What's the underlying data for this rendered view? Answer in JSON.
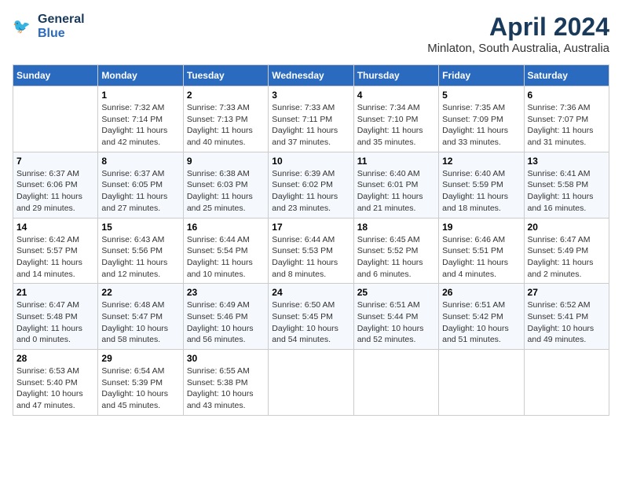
{
  "header": {
    "logo_line1": "General",
    "logo_line2": "Blue",
    "title": "April 2024",
    "subtitle": "Minlaton, South Australia, Australia"
  },
  "days_of_week": [
    "Sunday",
    "Monday",
    "Tuesday",
    "Wednesday",
    "Thursday",
    "Friday",
    "Saturday"
  ],
  "weeks": [
    [
      {
        "day": "",
        "info": ""
      },
      {
        "day": "1",
        "info": "Sunrise: 7:32 AM\nSunset: 7:14 PM\nDaylight: 11 hours\nand 42 minutes."
      },
      {
        "day": "2",
        "info": "Sunrise: 7:33 AM\nSunset: 7:13 PM\nDaylight: 11 hours\nand 40 minutes."
      },
      {
        "day": "3",
        "info": "Sunrise: 7:33 AM\nSunset: 7:11 PM\nDaylight: 11 hours\nand 37 minutes."
      },
      {
        "day": "4",
        "info": "Sunrise: 7:34 AM\nSunset: 7:10 PM\nDaylight: 11 hours\nand 35 minutes."
      },
      {
        "day": "5",
        "info": "Sunrise: 7:35 AM\nSunset: 7:09 PM\nDaylight: 11 hours\nand 33 minutes."
      },
      {
        "day": "6",
        "info": "Sunrise: 7:36 AM\nSunset: 7:07 PM\nDaylight: 11 hours\nand 31 minutes."
      }
    ],
    [
      {
        "day": "7",
        "info": "Sunrise: 6:37 AM\nSunset: 6:06 PM\nDaylight: 11 hours\nand 29 minutes."
      },
      {
        "day": "8",
        "info": "Sunrise: 6:37 AM\nSunset: 6:05 PM\nDaylight: 11 hours\nand 27 minutes."
      },
      {
        "day": "9",
        "info": "Sunrise: 6:38 AM\nSunset: 6:03 PM\nDaylight: 11 hours\nand 25 minutes."
      },
      {
        "day": "10",
        "info": "Sunrise: 6:39 AM\nSunset: 6:02 PM\nDaylight: 11 hours\nand 23 minutes."
      },
      {
        "day": "11",
        "info": "Sunrise: 6:40 AM\nSunset: 6:01 PM\nDaylight: 11 hours\nand 21 minutes."
      },
      {
        "day": "12",
        "info": "Sunrise: 6:40 AM\nSunset: 5:59 PM\nDaylight: 11 hours\nand 18 minutes."
      },
      {
        "day": "13",
        "info": "Sunrise: 6:41 AM\nSunset: 5:58 PM\nDaylight: 11 hours\nand 16 minutes."
      }
    ],
    [
      {
        "day": "14",
        "info": "Sunrise: 6:42 AM\nSunset: 5:57 PM\nDaylight: 11 hours\nand 14 minutes."
      },
      {
        "day": "15",
        "info": "Sunrise: 6:43 AM\nSunset: 5:56 PM\nDaylight: 11 hours\nand 12 minutes."
      },
      {
        "day": "16",
        "info": "Sunrise: 6:44 AM\nSunset: 5:54 PM\nDaylight: 11 hours\nand 10 minutes."
      },
      {
        "day": "17",
        "info": "Sunrise: 6:44 AM\nSunset: 5:53 PM\nDaylight: 11 hours\nand 8 minutes."
      },
      {
        "day": "18",
        "info": "Sunrise: 6:45 AM\nSunset: 5:52 PM\nDaylight: 11 hours\nand 6 minutes."
      },
      {
        "day": "19",
        "info": "Sunrise: 6:46 AM\nSunset: 5:51 PM\nDaylight: 11 hours\nand 4 minutes."
      },
      {
        "day": "20",
        "info": "Sunrise: 6:47 AM\nSunset: 5:49 PM\nDaylight: 11 hours\nand 2 minutes."
      }
    ],
    [
      {
        "day": "21",
        "info": "Sunrise: 6:47 AM\nSunset: 5:48 PM\nDaylight: 11 hours\nand 0 minutes."
      },
      {
        "day": "22",
        "info": "Sunrise: 6:48 AM\nSunset: 5:47 PM\nDaylight: 10 hours\nand 58 minutes."
      },
      {
        "day": "23",
        "info": "Sunrise: 6:49 AM\nSunset: 5:46 PM\nDaylight: 10 hours\nand 56 minutes."
      },
      {
        "day": "24",
        "info": "Sunrise: 6:50 AM\nSunset: 5:45 PM\nDaylight: 10 hours\nand 54 minutes."
      },
      {
        "day": "25",
        "info": "Sunrise: 6:51 AM\nSunset: 5:44 PM\nDaylight: 10 hours\nand 52 minutes."
      },
      {
        "day": "26",
        "info": "Sunrise: 6:51 AM\nSunset: 5:42 PM\nDaylight: 10 hours\nand 51 minutes."
      },
      {
        "day": "27",
        "info": "Sunrise: 6:52 AM\nSunset: 5:41 PM\nDaylight: 10 hours\nand 49 minutes."
      }
    ],
    [
      {
        "day": "28",
        "info": "Sunrise: 6:53 AM\nSunset: 5:40 PM\nDaylight: 10 hours\nand 47 minutes."
      },
      {
        "day": "29",
        "info": "Sunrise: 6:54 AM\nSunset: 5:39 PM\nDaylight: 10 hours\nand 45 minutes."
      },
      {
        "day": "30",
        "info": "Sunrise: 6:55 AM\nSunset: 5:38 PM\nDaylight: 10 hours\nand 43 minutes."
      },
      {
        "day": "",
        "info": ""
      },
      {
        "day": "",
        "info": ""
      },
      {
        "day": "",
        "info": ""
      },
      {
        "day": "",
        "info": ""
      }
    ]
  ]
}
